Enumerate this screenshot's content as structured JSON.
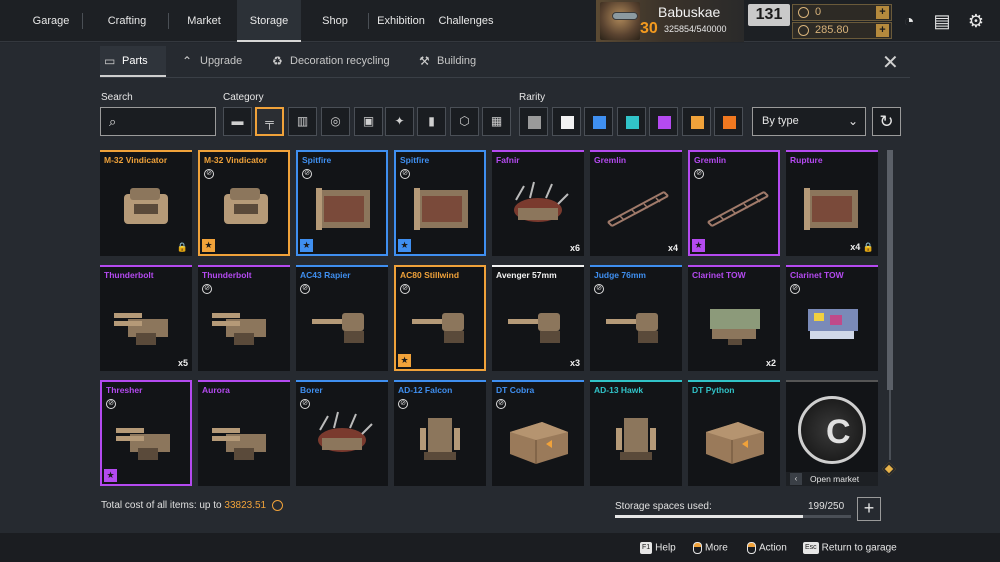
{
  "nav": {
    "items": [
      {
        "label": "Garage"
      },
      {
        "label": "Crafting"
      },
      {
        "label": "Market"
      },
      {
        "label": "Storage"
      },
      {
        "label": "Shop"
      },
      {
        "label": "Exhibition"
      },
      {
        "label": "Challenges"
      }
    ],
    "active": "Storage"
  },
  "profile": {
    "name": "Babuskae",
    "level": "30",
    "xp": "325854/540000",
    "badge": "131"
  },
  "currency": {
    "primary": "0",
    "coins": "285.80"
  },
  "tabs": [
    {
      "label": "Parts",
      "icon": "parts-icon"
    },
    {
      "label": "Upgrade",
      "icon": "upgrade-icon"
    },
    {
      "label": "Decoration recycling",
      "icon": "recycling-icon"
    },
    {
      "label": "Building",
      "icon": "building-icon"
    }
  ],
  "filters": {
    "search_label": "Search",
    "search_placeholder": "",
    "category_label": "Category",
    "categories": [
      "cabin-icon",
      "weapon-icon",
      "module-icon",
      "movement-icon",
      "frame-icon",
      "decor-icon",
      "paint-icon",
      "resource-icon",
      "all-icon"
    ],
    "rarity_label": "Rarity",
    "rarity_colors": [
      "#9a9a9a",
      "#f2f2f2",
      "#3f8ff0",
      "#31c3c8",
      "#b44af0",
      "#f0a23a",
      "#f07820"
    ],
    "sort_value": "By type"
  },
  "items": [
    {
      "name": "M-32 Vindicator",
      "color": "#f0a23a",
      "qty": "",
      "lock": true,
      "nocraft": false,
      "star": false,
      "sel": false,
      "art": "cabin"
    },
    {
      "name": "M-32 Vindicator",
      "color": "#f0a23a",
      "qty": "",
      "lock": false,
      "nocraft": true,
      "star": true,
      "sel": true,
      "art": "cabin"
    },
    {
      "name": "Spitfire",
      "color": "#3f8ff0",
      "qty": "",
      "lock": false,
      "nocraft": true,
      "star": true,
      "sel": true,
      "art": "box"
    },
    {
      "name": "Spitfire",
      "color": "#3f8ff0",
      "qty": "",
      "lock": false,
      "nocraft": true,
      "star": true,
      "sel": true,
      "art": "box"
    },
    {
      "name": "Fafnir",
      "color": "#b44af0",
      "qty": "x6",
      "lock": false,
      "nocraft": false,
      "star": false,
      "sel": false,
      "art": "spiky"
    },
    {
      "name": "Gremlin",
      "color": "#b44af0",
      "qty": "x4",
      "lock": false,
      "nocraft": false,
      "star": false,
      "sel": false,
      "art": "frame"
    },
    {
      "name": "Gremlin",
      "color": "#b44af0",
      "qty": "",
      "lock": false,
      "nocraft": true,
      "star": true,
      "sel": true,
      "art": "frame"
    },
    {
      "name": "Rupture",
      "color": "#b44af0",
      "qty": "x4",
      "lock": true,
      "nocraft": false,
      "star": false,
      "sel": false,
      "art": "box"
    },
    {
      "name": "Thunderbolt",
      "color": "#b44af0",
      "qty": "x5",
      "lock": false,
      "nocraft": false,
      "star": false,
      "sel": false,
      "art": "gun"
    },
    {
      "name": "Thunderbolt",
      "color": "#b44af0",
      "qty": "",
      "lock": false,
      "nocraft": true,
      "star": false,
      "sel": false,
      "art": "gun"
    },
    {
      "name": "AC43 Rapier",
      "color": "#3f8ff0",
      "qty": "",
      "lock": false,
      "nocraft": true,
      "star": false,
      "sel": false,
      "art": "cannon"
    },
    {
      "name": "AC80 Stillwind",
      "color": "#f0a23a",
      "qty": "",
      "lock": false,
      "nocraft": true,
      "star": true,
      "sel": true,
      "art": "cannon"
    },
    {
      "name": "Avenger 57mm",
      "color": "#f2f2f2",
      "qty": "x3",
      "lock": false,
      "nocraft": false,
      "star": false,
      "sel": false,
      "art": "cannon"
    },
    {
      "name": "Judge 76mm",
      "color": "#3f8ff0",
      "qty": "",
      "lock": false,
      "nocraft": true,
      "star": false,
      "sel": false,
      "art": "cannon"
    },
    {
      "name": "Clarinet TOW",
      "color": "#b44af0",
      "qty": "x2",
      "lock": false,
      "nocraft": false,
      "star": false,
      "sel": false,
      "art": "launcher"
    },
    {
      "name": "Clarinet TOW",
      "color": "#b44af0",
      "qty": "",
      "lock": false,
      "nocraft": true,
      "star": false,
      "sel": false,
      "art": "launcher-blue"
    },
    {
      "name": "Thresher",
      "color": "#b44af0",
      "qty": "",
      "lock": false,
      "nocraft": true,
      "star": true,
      "sel": true,
      "art": "gun"
    },
    {
      "name": "Aurora",
      "color": "#b44af0",
      "qty": "",
      "lock": false,
      "nocraft": false,
      "star": false,
      "sel": false,
      "art": "gun"
    },
    {
      "name": "Borer",
      "color": "#3f8ff0",
      "qty": "",
      "lock": false,
      "nocraft": true,
      "star": false,
      "sel": false,
      "art": "spiky"
    },
    {
      "name": "AD-12 Falcon",
      "color": "#3f8ff0",
      "qty": "",
      "lock": false,
      "nocraft": true,
      "star": false,
      "sel": false,
      "art": "turret"
    },
    {
      "name": "DT Cobra",
      "color": "#3f8ff0",
      "qty": "",
      "lock": false,
      "nocraft": true,
      "star": false,
      "sel": false,
      "art": "crate"
    },
    {
      "name": "AD-13 Hawk",
      "color": "#31c3c8",
      "qty": "",
      "lock": false,
      "nocraft": false,
      "star": false,
      "sel": false,
      "art": "turret"
    },
    {
      "name": "DT Python",
      "color": "#31c3c8",
      "qty": "",
      "lock": false,
      "nocraft": false,
      "star": false,
      "sel": false,
      "art": "crate"
    }
  ],
  "market_tile": {
    "label": "Open market",
    "icon": "market-coin-icon"
  },
  "footer": {
    "total_prefix": "Total cost of all items: up to",
    "total_amount": "33823.51",
    "storage_label": "Storage spaces used:",
    "storage_value": "199/250",
    "storage_fraction": 0.796
  },
  "hints": [
    {
      "key": "F1",
      "label": "Help"
    },
    {
      "key": "mouse-right",
      "label": "More"
    },
    {
      "key": "mouse-left",
      "label": "Action"
    },
    {
      "key": "Esc",
      "label": "Return to garage"
    }
  ]
}
